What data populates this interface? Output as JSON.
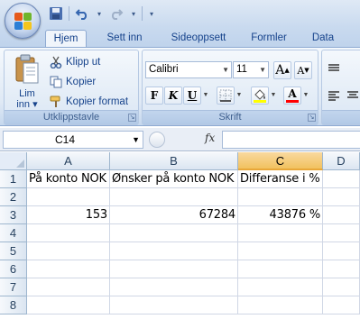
{
  "quick_access": {
    "icons": [
      "save-icon",
      "undo-icon",
      "redo-icon",
      "customize-dropdown-icon"
    ]
  },
  "tabs": [
    "Hjem",
    "Sett inn",
    "Sideoppsett",
    "Formler",
    "Data"
  ],
  "active_tab": "Hjem",
  "ribbon": {
    "clipboard": {
      "paste_label_line1": "Lim",
      "paste_label_line2": "inn ▾",
      "cut": "Klipp ut",
      "copy": "Kopier",
      "format_painter": "Kopier format",
      "group_label": "Utklippstavle"
    },
    "font": {
      "font_name": "Calibri",
      "font_size": "11",
      "bold": "F",
      "italic": "K",
      "underline": "U",
      "grow_font": "A",
      "shrink_font": "A",
      "font_color_glyph": "A",
      "group_label": "Skrift",
      "fill_color": "#ffff00",
      "font_color": "#ff0000"
    }
  },
  "formula_bar": {
    "name_box": "C14",
    "fx": "fx",
    "formula": ""
  },
  "sheet": {
    "columns": [
      "A",
      "B",
      "C",
      "D"
    ],
    "selected_column": "C",
    "rows": [
      "1",
      "2",
      "3",
      "4",
      "5",
      "6",
      "7",
      "8"
    ],
    "cells": {
      "A1": "På konto NOK",
      "B1": "Ønsker på konto NOK",
      "C1": "Differanse i %",
      "A3": "153",
      "B3": "67284",
      "C3": "43876 %"
    }
  }
}
